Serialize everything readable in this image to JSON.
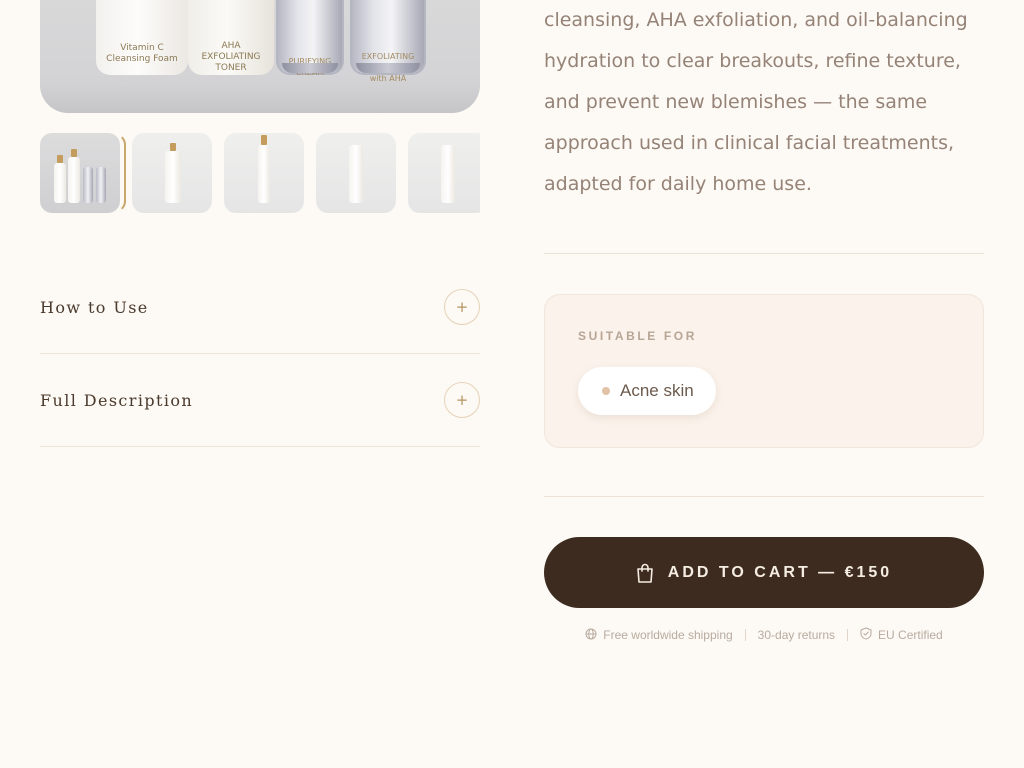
{
  "gallery": {
    "bottle_labels": [
      "Vitamin C\nCleansing Foam",
      "AHA\nEXFOLIATING\nTONER",
      "PURIFYING\nCREAM",
      "EXFOLIATING\nCREAM\nwith AHA"
    ],
    "thumbnail_count": 5,
    "active_thumbnail": 1
  },
  "accordion": {
    "items": [
      {
        "label": "How to Use",
        "icon": "plus-icon"
      },
      {
        "label": "Full Description",
        "icon": "plus-icon"
      }
    ]
  },
  "description": {
    "text": "cleansing, AHA exfoliation, and oil-balancing hydration to clear breakouts, refine texture, and prevent new blemishes — the same approach used in clinical facial treatments, adapted for daily home use."
  },
  "suitable_for": {
    "heading": "SUITABLE FOR",
    "chips": [
      "Acne skin"
    ]
  },
  "cart": {
    "label": "ADD TO CART — €150",
    "icon": "shopping-bag-icon"
  },
  "trust_badges": [
    {
      "label": "Free worldwide shipping",
      "icon": "globe-icon"
    },
    {
      "label": "30-day returns",
      "icon": ""
    },
    {
      "label": "EU Certified",
      "icon": "shield-check-icon"
    }
  ],
  "colors": {
    "background": "#fdf9f4",
    "button": "#3d2b1f",
    "accent_gold": "#c9a66b",
    "text_muted": "#958377"
  }
}
